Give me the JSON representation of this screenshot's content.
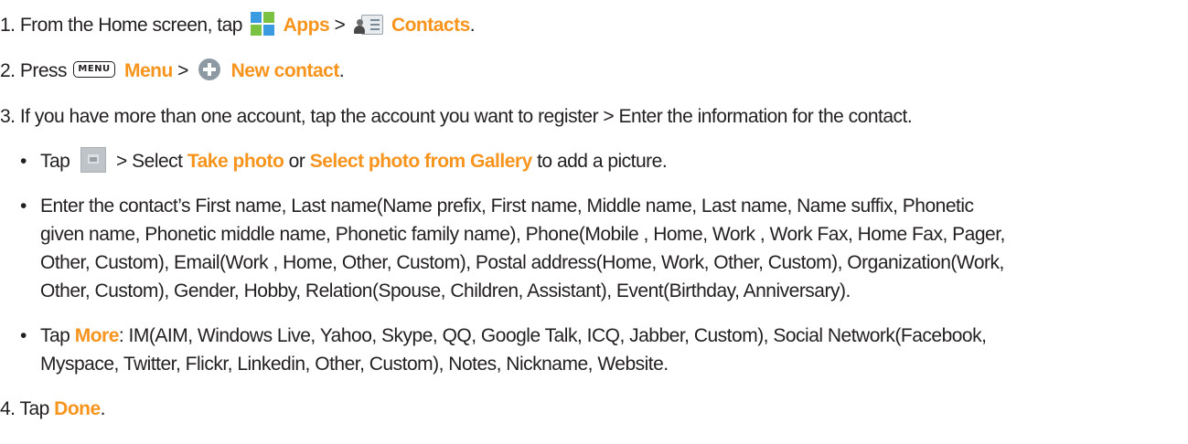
{
  "steps": {
    "s1": {
      "prefix": "1. From the Home screen, tap",
      "apps": "Apps",
      "sep": ">",
      "contacts": "Contacts",
      "end": "."
    },
    "s2": {
      "prefix": "2. Press",
      "menu_key": "MENU",
      "menu": "Menu",
      "sep": ">",
      "new_contact": "New contact",
      "end": "."
    },
    "s3": {
      "text": "3. If you have more than one account, tap the account you want to register > Enter the information for the contact."
    },
    "s4": {
      "prefix": "4. Tap",
      "done": "Done",
      "end": "."
    }
  },
  "bullets": {
    "dot": "•",
    "b1": {
      "tap": "Tap",
      "mid": "> Select",
      "take_photo": "Take photo",
      "or": "or",
      "select_gallery": "Select photo from Gallery",
      "end": "to add a picture."
    },
    "b2": {
      "l1": "Enter the contact’s First name, Last name(Name prefix, First name, Middle name, Last name, Name suffix, Phonetic",
      "l2": "given name, Phonetic middle name, Phonetic family name),  Phone(Mobile , Home, Work , Work Fax, Home Fax, Pager,",
      "l3": "Other, Custom), Email(Work , Home, Other, Custom), Postal address(Home, Work, Other, Custom), Organization(Work,",
      "l4": "Other, Custom), Gender, Hobby, Relation(Spouse, Children, Assistant), Event(Birthday, Anniversary)."
    },
    "b3": {
      "tap": "Tap",
      "more": "More",
      "l1_rest": ": IM(AIM, Windows Live, Yahoo, Skype, QQ, Google Talk, ICQ,  Jabber,  Custom), Social Network(Facebook,",
      "l2": "Myspace, Twitter, Flickr, Linkedin, Other, Custom), Notes, Nickname, Website."
    }
  },
  "icons": [
    "apps-icon",
    "contacts-icon",
    "menu-key-icon",
    "plus-circle-icon",
    "photo-icon"
  ],
  "colors": {
    "accent": "#f7941d",
    "text": "#231f20"
  }
}
